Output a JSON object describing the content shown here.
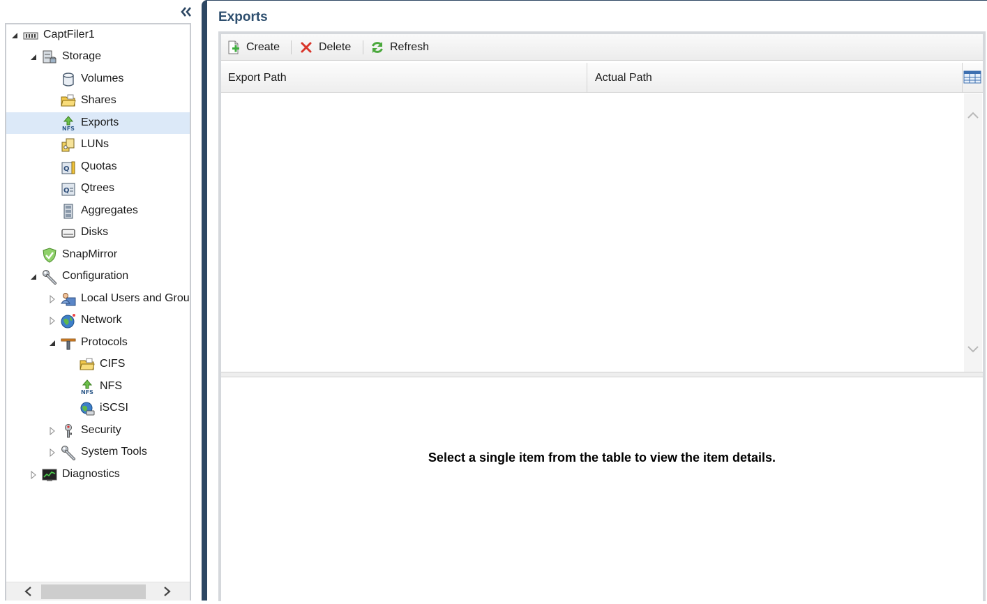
{
  "nav": {
    "tree": [
      {
        "label": "CaptFiler1",
        "icon": "filer-icon",
        "expander": "expanded"
      },
      {
        "label": "Storage",
        "icon": "storage-icon",
        "expander": "expanded"
      },
      {
        "label": "Volumes",
        "icon": "volume-icon",
        "expander": "none"
      },
      {
        "label": "Shares",
        "icon": "shares-folder-icon",
        "expander": "none"
      },
      {
        "label": "Exports",
        "icon": "nfs-export-icon",
        "expander": "none",
        "selected": true
      },
      {
        "label": "LUNs",
        "icon": "lun-icon",
        "expander": "none"
      },
      {
        "label": "Quotas",
        "icon": "quota-icon",
        "expander": "none"
      },
      {
        "label": "Qtrees",
        "icon": "qtree-icon",
        "expander": "none"
      },
      {
        "label": "Aggregates",
        "icon": "aggregate-icon",
        "expander": "none"
      },
      {
        "label": "Disks",
        "icon": "disk-icon",
        "expander": "none"
      },
      {
        "label": "SnapMirror",
        "icon": "snapmirror-shield-icon",
        "expander": "none"
      },
      {
        "label": "Configuration",
        "icon": "wrench-icon",
        "expander": "expanded"
      },
      {
        "label": "Local Users and Grou",
        "icon": "users-groups-icon",
        "expander": "collapsed"
      },
      {
        "label": "Network",
        "icon": "globe-icon",
        "expander": "collapsed"
      },
      {
        "label": "Protocols",
        "icon": "protocols-icon",
        "expander": "expanded"
      },
      {
        "label": "CIFS",
        "icon": "cifs-folder-icon",
        "expander": "none"
      },
      {
        "label": "NFS",
        "icon": "nfs-icon",
        "expander": "none"
      },
      {
        "label": "iSCSI",
        "icon": "iscsi-icon",
        "expander": "none"
      },
      {
        "label": "Security",
        "icon": "security-key-icon",
        "expander": "collapsed"
      },
      {
        "label": "System Tools",
        "icon": "system-tools-icon",
        "expander": "collapsed"
      },
      {
        "label": "Diagnostics",
        "icon": "diagnostics-monitor-icon",
        "expander": "collapsed"
      }
    ]
  },
  "main": {
    "title": "Exports",
    "toolbar": {
      "create_label": "Create",
      "delete_label": "Delete",
      "refresh_label": "Refresh"
    },
    "table": {
      "columns": [
        "Export Path",
        "Actual Path"
      ],
      "rows": []
    },
    "details": {
      "message": "Select a single item from the table to view the item details."
    }
  },
  "colors": {
    "accent": "#2d4763",
    "title": "#2d4e6e",
    "selected_row": "#dce9f8"
  }
}
